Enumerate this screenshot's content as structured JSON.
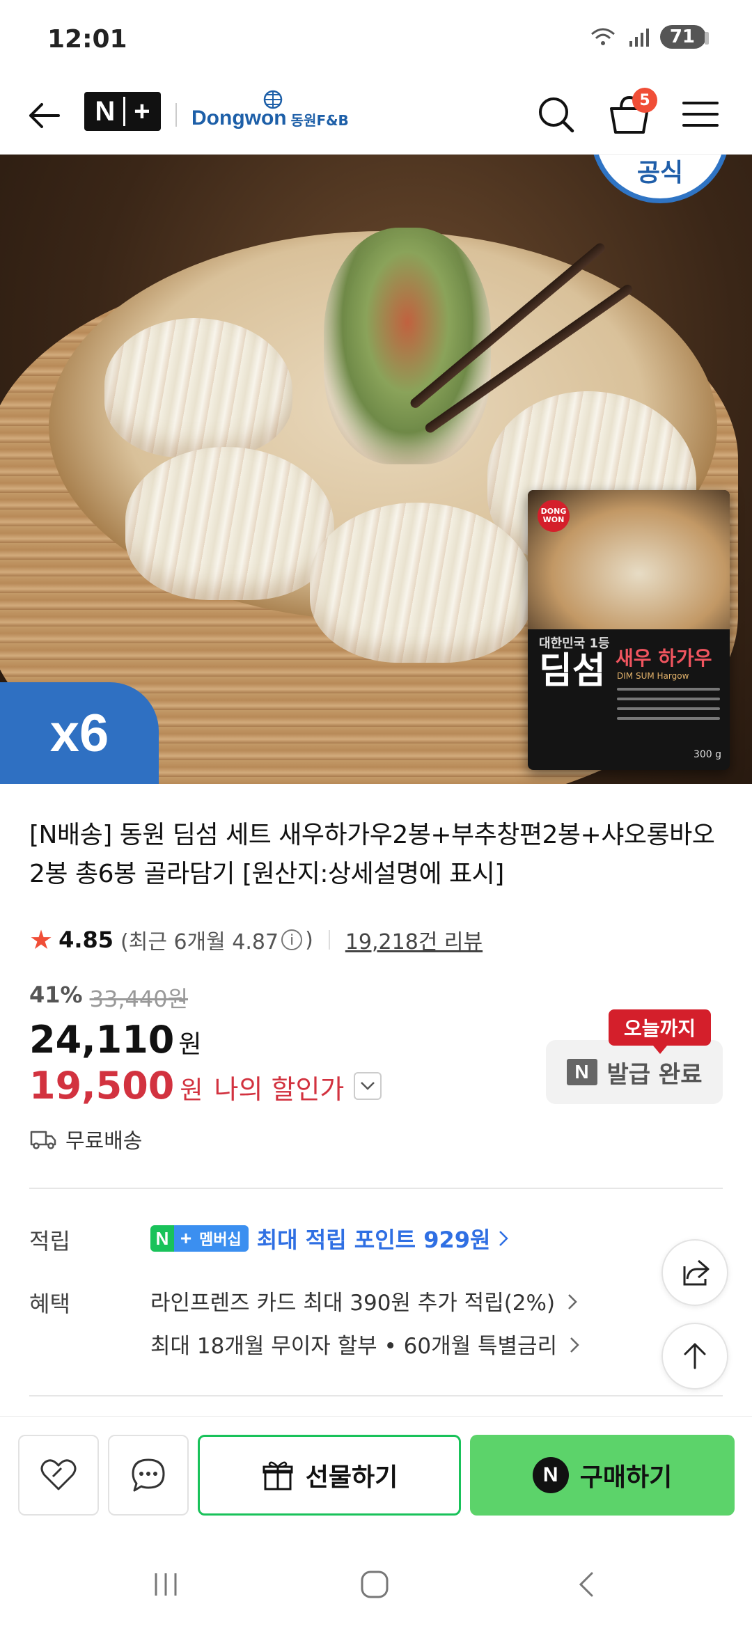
{
  "status_bar": {
    "time": "12:01",
    "battery": "71"
  },
  "header": {
    "np_logo": {
      "left": "N",
      "right": "+"
    },
    "brand": {
      "name": "Dongwon",
      "sub": "동원F&B"
    },
    "cart_count": "5"
  },
  "hero": {
    "official_badge": "공식",
    "quantity_badge": "x6",
    "package": {
      "maker": "DONG WON",
      "line": "대한민국 1등",
      "brand": "딤섬",
      "product": "새우 하가우",
      "product_en": "DIM SUM Hargow",
      "weight": "300 g"
    }
  },
  "product": {
    "title": "[N배송] 동원 딤섬 세트 새우하가우2봉+부추창편2봉+샤오롱바오2봉 총6봉 골라담기 [원산지:상세설명에 표시]",
    "rating": "4.85",
    "rating_recent_prefix": "(최근 6개월 4.87",
    "rating_recent_suffix": ")",
    "review_count": "19,218건 리뷰",
    "discount_percent": "41%",
    "original_price": "33,440원",
    "price": "24,110",
    "price_unit": "원",
    "my_price": "19,500",
    "my_price_unit": "원",
    "my_price_label": "나의 할인가",
    "coupon_tag": "오늘까지",
    "coupon_button": "발급 완료",
    "shipping": "무료배송"
  },
  "benefits": {
    "points_label": "적립",
    "membership_badge": "멤버십",
    "points_text": "최대 적립 포인트 929원",
    "benefit_label": "혜택",
    "benefit_1": "라인프렌즈 카드 최대 390원 추가 적립(2%)",
    "benefit_2": "최대 18개월 무이자 할부 • 60개월 특별금리"
  },
  "action_bar": {
    "gift_label": "선물하기",
    "buy_label": "구매하기",
    "buy_badge": "N"
  },
  "colors": {
    "accent_red": "#d2323f",
    "naver_green": "#19c25a",
    "buy_green": "#5cd36a",
    "link_blue": "#2f6fe3",
    "brand_blue": "#1d5fa8"
  },
  "icons": {
    "back": "arrow-left-icon",
    "search": "search-icon",
    "cart": "cart-icon",
    "menu": "hamburger-icon",
    "share": "share-icon",
    "top": "arrow-up-icon",
    "like": "heart-icon",
    "talk": "chat-icon",
    "gift": "gift-icon",
    "shipping": "truck-icon"
  }
}
